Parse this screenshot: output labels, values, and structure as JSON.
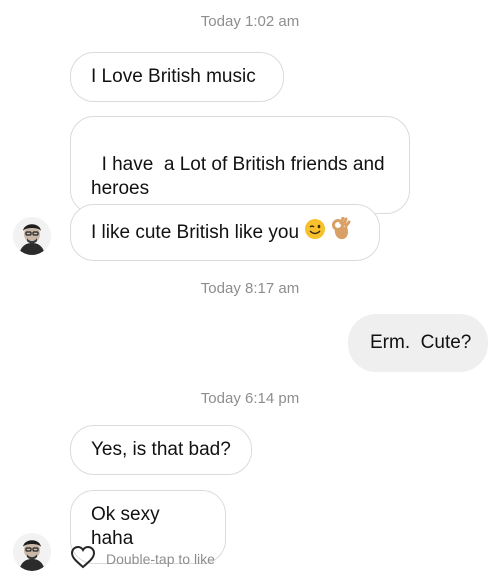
{
  "thread": {
    "timestamps": [
      "Today 1:02 am",
      "Today 8:17 am",
      "Today 6:14 pm"
    ],
    "messages": [
      {
        "text": "I Love British music"
      },
      {
        "text": "I have  a Lot of British friends and heroes"
      },
      {
        "text": "I like cute British like you"
      },
      {
        "text": "Erm.  Cute?"
      },
      {
        "text": "Yes, is that bad?"
      },
      {
        "text": "Ok sexy haha"
      }
    ],
    "emojis": [
      "winking-face-emoji",
      "ok-hand-emoji"
    ]
  },
  "footer": {
    "like_hint": "Double-tap to like",
    "like_icon": "heart-outline-icon"
  },
  "colors": {
    "incoming_border": "#dbdbdb",
    "outgoing_bg": "#efefef",
    "meta_text": "#8e8e8e"
  }
}
